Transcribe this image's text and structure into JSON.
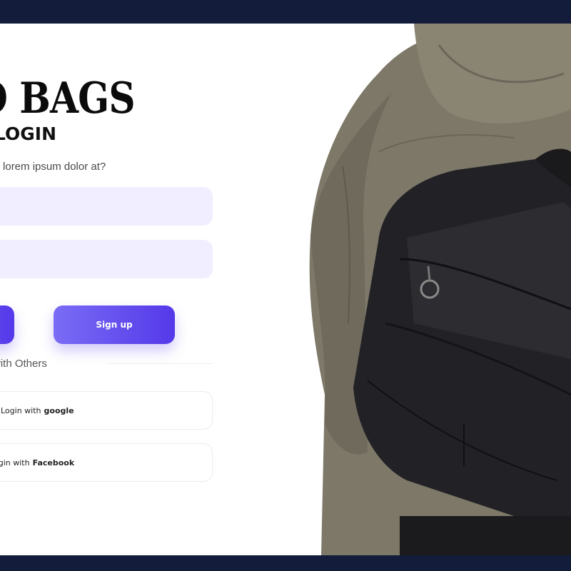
{
  "brand": {
    "title": "O BAGS"
  },
  "login": {
    "heading": "LOGIN",
    "subtitle": "rted lorem ipsum dolor at?",
    "email_placeholder": "",
    "password_placeholder": "",
    "signup_label": "Sign up",
    "divider_text": "with Others",
    "google_prefix": "Login with",
    "google_brand": "google",
    "facebook_prefix": "ogin with",
    "facebook_brand": "Facebook"
  },
  "colors": {
    "background_frame": "#131c3a",
    "input_bg": "#f1efff",
    "accent_start": "#7a6cf5",
    "accent_end": "#5439e9"
  },
  "photo": {
    "subject": "person-wearing-black-backpack"
  }
}
